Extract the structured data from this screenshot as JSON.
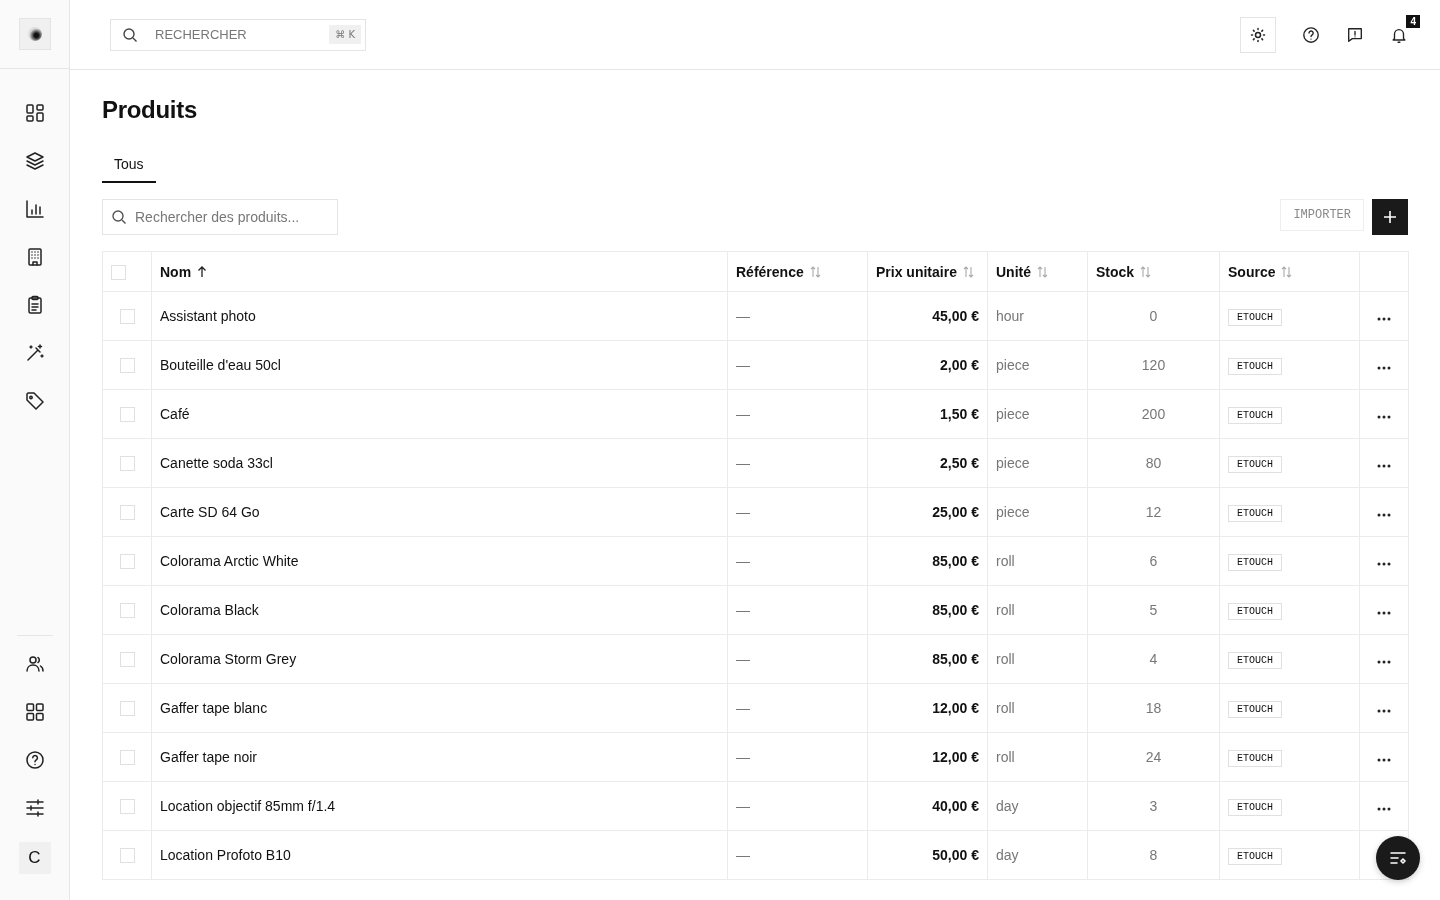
{
  "avatar": {
    "initial": "C"
  },
  "topbar": {
    "search_placeholder": "RECHERCHER",
    "shortcut": "⌘ K",
    "notifications": "4"
  },
  "page": {
    "title": "Produits"
  },
  "tabs": [
    {
      "label": "Tous",
      "selected": true
    }
  ],
  "filter": {
    "placeholder": "Rechercher des produits..."
  },
  "actions": {
    "import": "IMPORTER"
  },
  "table": {
    "select_all": {
      "checked": false
    },
    "columns": [
      {
        "label": "Nom",
        "sorted": true
      },
      {
        "label": "Référence",
        "sorted": false
      },
      {
        "label": "Prix unitaire",
        "sorted": false
      },
      {
        "label": "Unité",
        "sorted": false
      },
      {
        "label": "Stock",
        "sorted": false
      },
      {
        "label": "Source",
        "sorted": false
      }
    ],
    "rows": [
      {
        "checked": false,
        "name": "Assistant photo",
        "reference": "—",
        "price": "45,00 €",
        "unit": "hour",
        "stock": "0",
        "source": "ETOUCH"
      },
      {
        "checked": false,
        "name": "Bouteille d'eau 50cl",
        "reference": "—",
        "price": "2,00 €",
        "unit": "piece",
        "stock": "120",
        "source": "ETOUCH"
      },
      {
        "checked": false,
        "name": "Café",
        "reference": "—",
        "price": "1,50 €",
        "unit": "piece",
        "stock": "200",
        "source": "ETOUCH"
      },
      {
        "checked": false,
        "name": "Canette soda 33cl",
        "reference": "—",
        "price": "2,50 €",
        "unit": "piece",
        "stock": "80",
        "source": "ETOUCH"
      },
      {
        "checked": false,
        "name": "Carte SD 64 Go",
        "reference": "—",
        "price": "25,00 €",
        "unit": "piece",
        "stock": "12",
        "source": "ETOUCH"
      },
      {
        "checked": false,
        "name": "Colorama Arctic White",
        "reference": "—",
        "price": "85,00 €",
        "unit": "roll",
        "stock": "6",
        "source": "ETOUCH"
      },
      {
        "checked": false,
        "name": "Colorama Black",
        "reference": "—",
        "price": "85,00 €",
        "unit": "roll",
        "stock": "5",
        "source": "ETOUCH"
      },
      {
        "checked": false,
        "name": "Colorama Storm Grey",
        "reference": "—",
        "price": "85,00 €",
        "unit": "roll",
        "stock": "4",
        "source": "ETOUCH"
      },
      {
        "checked": false,
        "name": "Gaffer tape blanc",
        "reference": "—",
        "price": "12,00 €",
        "unit": "roll",
        "stock": "18",
        "source": "ETOUCH"
      },
      {
        "checked": false,
        "name": "Gaffer tape noir",
        "reference": "—",
        "price": "12,00 €",
        "unit": "roll",
        "stock": "24",
        "source": "ETOUCH"
      },
      {
        "checked": false,
        "name": "Location objectif 85mm f/1.4",
        "reference": "—",
        "price": "40,00 €",
        "unit": "day",
        "stock": "3",
        "source": "ETOUCH"
      },
      {
        "checked": false,
        "name": "Location Profoto B10",
        "reference": "—",
        "price": "50,00 €",
        "unit": "day",
        "stock": "8",
        "source": "ETOUCH"
      }
    ]
  }
}
